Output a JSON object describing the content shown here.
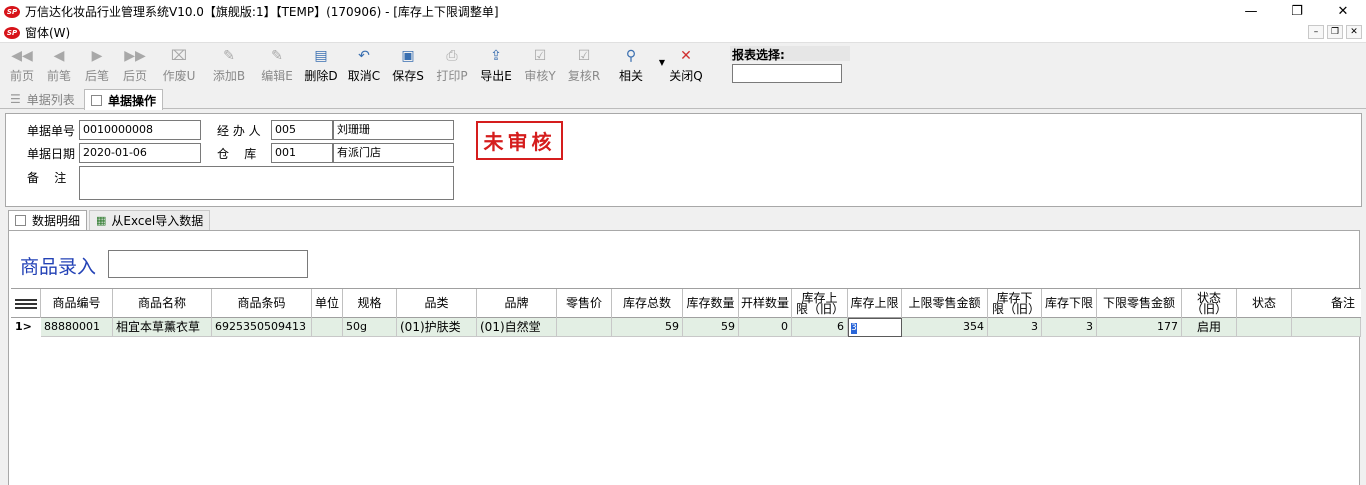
{
  "window": {
    "title": "万信达化妆品行业管理系统V10.0【旗舰版:1】【TEMP】(170906) - [库存上下限调整单]",
    "logo_text": "SP"
  },
  "menu": {
    "item": "窗体(W)"
  },
  "toolbar": {
    "buttons": [
      {
        "label": "前页",
        "icon": "◀◀"
      },
      {
        "label": "前笔",
        "icon": "◀"
      },
      {
        "label": "后笔",
        "icon": "▶"
      },
      {
        "label": "后页",
        "icon": "▶▶"
      },
      {
        "label": "作废U",
        "icon": "⌧"
      },
      {
        "label": "添加B",
        "icon": "✎"
      },
      {
        "label": "编辑E",
        "icon": "✎"
      },
      {
        "label": "删除D",
        "icon": "▤"
      },
      {
        "label": "取消C",
        "icon": "↶"
      },
      {
        "label": "保存S",
        "icon": "▣"
      },
      {
        "label": "打印P",
        "icon": "⎙"
      },
      {
        "label": "导出E",
        "icon": "⇪"
      },
      {
        "label": "审核Y",
        "icon": "☑"
      },
      {
        "label": "复核R",
        "icon": "☑"
      },
      {
        "label": "相关",
        "icon": "⚲"
      },
      {
        "label": "关闭Q",
        "icon": "✕"
      }
    ],
    "report_select_label": "报表选择:"
  },
  "tabs": {
    "list": "单据列表",
    "operate": "单据操作"
  },
  "form": {
    "doc_no_label": "单据单号",
    "doc_no": "0010000008",
    "handler_label": "经 办 人",
    "handler_code": "005",
    "handler_name": "刘珊珊",
    "date_label": "单据日期",
    "date": "2020-01-06",
    "warehouse_label": "仓    库",
    "warehouse_code": "001",
    "warehouse_name": "有派门店",
    "remark_label": "备    注",
    "status_stamp": "未审核"
  },
  "inner_tabs": {
    "detail": "数据明细",
    "import": "从Excel导入数据"
  },
  "goods_entry_label": "商品录入",
  "grid": {
    "columns": [
      "商品编号",
      "商品名称",
      "商品条码",
      "单位",
      "规格",
      "品类",
      "品牌",
      "零售价",
      "库存总数",
      "库存数量",
      "开样数量",
      "库存上限（旧）",
      "库存上限",
      "上限零售金额",
      "库存下限（旧）",
      "库存下限",
      "下限零售金额",
      "状态（旧）",
      "状态",
      "备注"
    ],
    "rows": [
      {
        "index": "1>",
        "code": "88880001",
        "name": "相宜本草薰衣草",
        "barcode": "6925350509413",
        "unit": "",
        "spec": "50g",
        "category": "(01)护肤类",
        "brand": "(01)自然堂",
        "price": "",
        "total_stock": "59",
        "stock_qty": "59",
        "sample_qty": "0",
        "upper_old": "6",
        "upper": "3",
        "upper_amount": "354",
        "lower_old": "3",
        "lower": "3",
        "lower_amount": "177",
        "status_old": "启用",
        "status": "",
        "remark": ""
      }
    ]
  }
}
